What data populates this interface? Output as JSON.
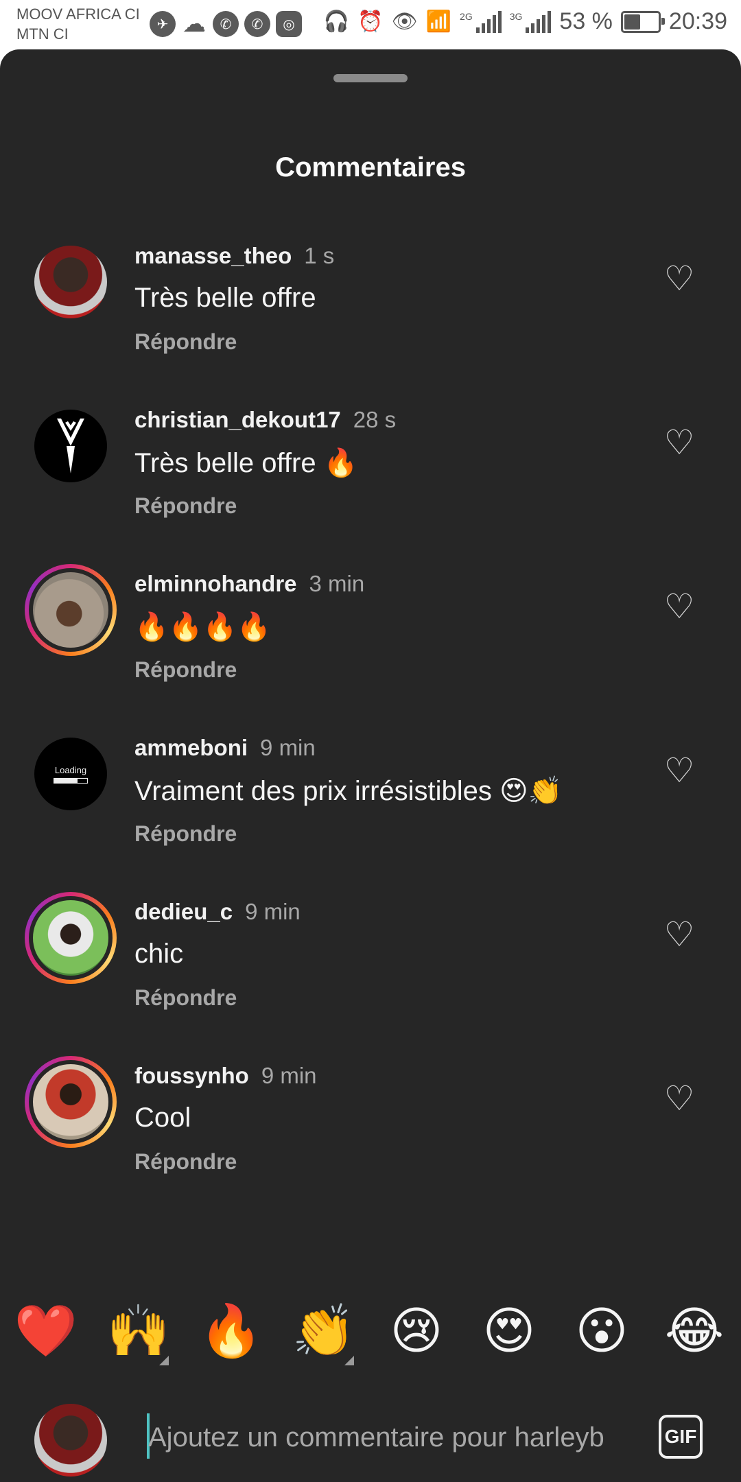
{
  "status_bar": {
    "carrier_line1": "MOOV AFRICA CI",
    "carrier_line2": "MTN CI",
    "left_icons": [
      "telegram-icon",
      "cloud-icon",
      "whatsapp-icon",
      "whatsapp-icon",
      "instagram-icon"
    ],
    "right_icons": [
      "headset-icon",
      "alarm-icon",
      "eye-icon",
      "wifi-icon",
      "signal-icon",
      "signal-icon",
      "battery-icon"
    ],
    "signal1_label": "2G",
    "signal2_label": "3G",
    "battery_text": "53 %",
    "battery_level": 0.53,
    "time": "20:39"
  },
  "sheet": {
    "title": "Commentaires"
  },
  "comments": [
    {
      "username": "manasse_theo",
      "time": "1 s",
      "text": "Très belle offre",
      "reply": "Répondre"
    },
    {
      "username": "christian_dekout17",
      "time": "28 s",
      "text": "Très belle offre 🔥",
      "reply": "Répondre"
    },
    {
      "username": "elminnohandre",
      "time": "3 min",
      "text": "🔥🔥🔥🔥",
      "reply": "Répondre"
    },
    {
      "username": "ammeboni",
      "time": "9 min",
      "text": "Vraiment des prix irrésistibles 😍👏",
      "reply": "Répondre",
      "avatar_text": "Loading"
    },
    {
      "username": "dedieu_c",
      "time": "9 min",
      "text": "chic",
      "reply": "Répondre"
    },
    {
      "username": "foussynho",
      "time": "9 min",
      "text": "Cool",
      "reply": "Répondre"
    }
  ],
  "quick_reactions": [
    "❤️",
    "🙌",
    "🔥",
    "👏",
    "😢",
    "😍",
    "😮",
    "😂"
  ],
  "composer": {
    "placeholder": "Ajoutez un commentaire pour harleyb",
    "gif_label": "GIF"
  },
  "colors": {
    "sheet_bg": "#262626",
    "secondary_text": "#a8a8a8",
    "caret": "#4fc3c3"
  }
}
